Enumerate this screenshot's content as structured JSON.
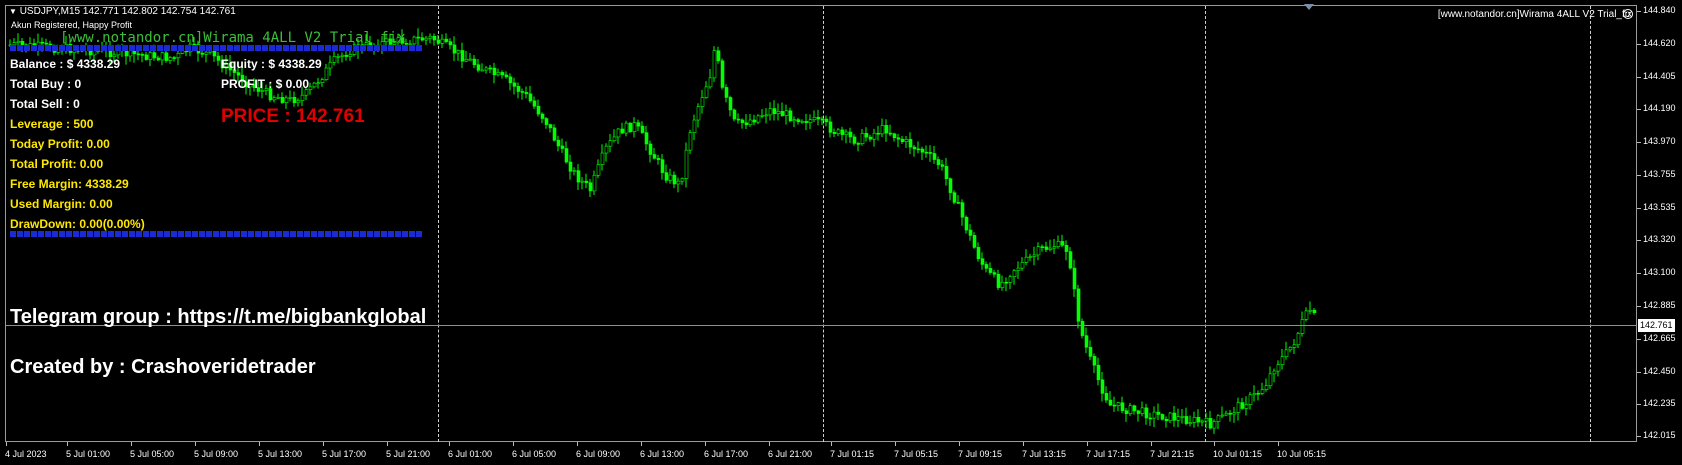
{
  "chart": {
    "symbol_header": "USDJPY,M15  142.771 142.802 142.754 142.761",
    "status_line": "Akun Registered, Happy Profit",
    "ea_name": "[www.notandor.cn]Wirama 4ALL V2 Trial_fix",
    "watermark": "[www.notandor.cn]Wirama 4ALL V2 Trial_fix",
    "current_price": "142.761",
    "icons": {
      "expert_status": "smiley-icon",
      "shift": "triangle-down-icon"
    },
    "colors": {
      "candle": "#00ff00",
      "background": "#000000",
      "price_text": "#e00000",
      "info_yellow": "#ffe800",
      "separator": "#1a2bd6"
    }
  },
  "price_axis": [
    "144.840",
    "144.620",
    "144.405",
    "144.190",
    "143.970",
    "143.755",
    "143.535",
    "143.320",
    "143.100",
    "142.885",
    "142.665",
    "142.450",
    "142.235",
    "142.015"
  ],
  "time_axis": [
    "4 Jul 2023",
    "5 Jul 01:00",
    "5 Jul 05:00",
    "5 Jul 09:00",
    "5 Jul 13:00",
    "5 Jul 17:00",
    "5 Jul 21:00",
    "6 Jul 01:00",
    "6 Jul 05:00",
    "6 Jul 09:00",
    "6 Jul 13:00",
    "6 Jul 17:00",
    "6 Jul 21:00",
    "7 Jul 01:15",
    "7 Jul 05:15",
    "7 Jul 09:15",
    "7 Jul 13:15",
    "7 Jul 17:15",
    "7 Jul 21:15",
    "10 Jul 01:15",
    "10 Jul 05:15"
  ],
  "panel": {
    "balance": "Balance : $ 4338.29",
    "equity": "Equity : $ 4338.29",
    "total_buy": "Total Buy   : 0",
    "profit": "PROFIT   : $ 0.00",
    "total_sell": "Total Sell  : 0",
    "price": "PRICE : 142.761",
    "leverage": "Leverage : 500",
    "today_profit": "Today Profit: 0.00",
    "total_profit": "Total Profit: 0.00",
    "free_margin": "Free Margin: 4338.29",
    "used_margin": "Used Margin: 0.00",
    "drawdown": "DrawDown: 0.00(0.00%)"
  },
  "footer_text": {
    "telegram": "Telegram group : https://t.me/bigbankglobal",
    "created_by": "Created by : Crashoveridetrader"
  }
}
